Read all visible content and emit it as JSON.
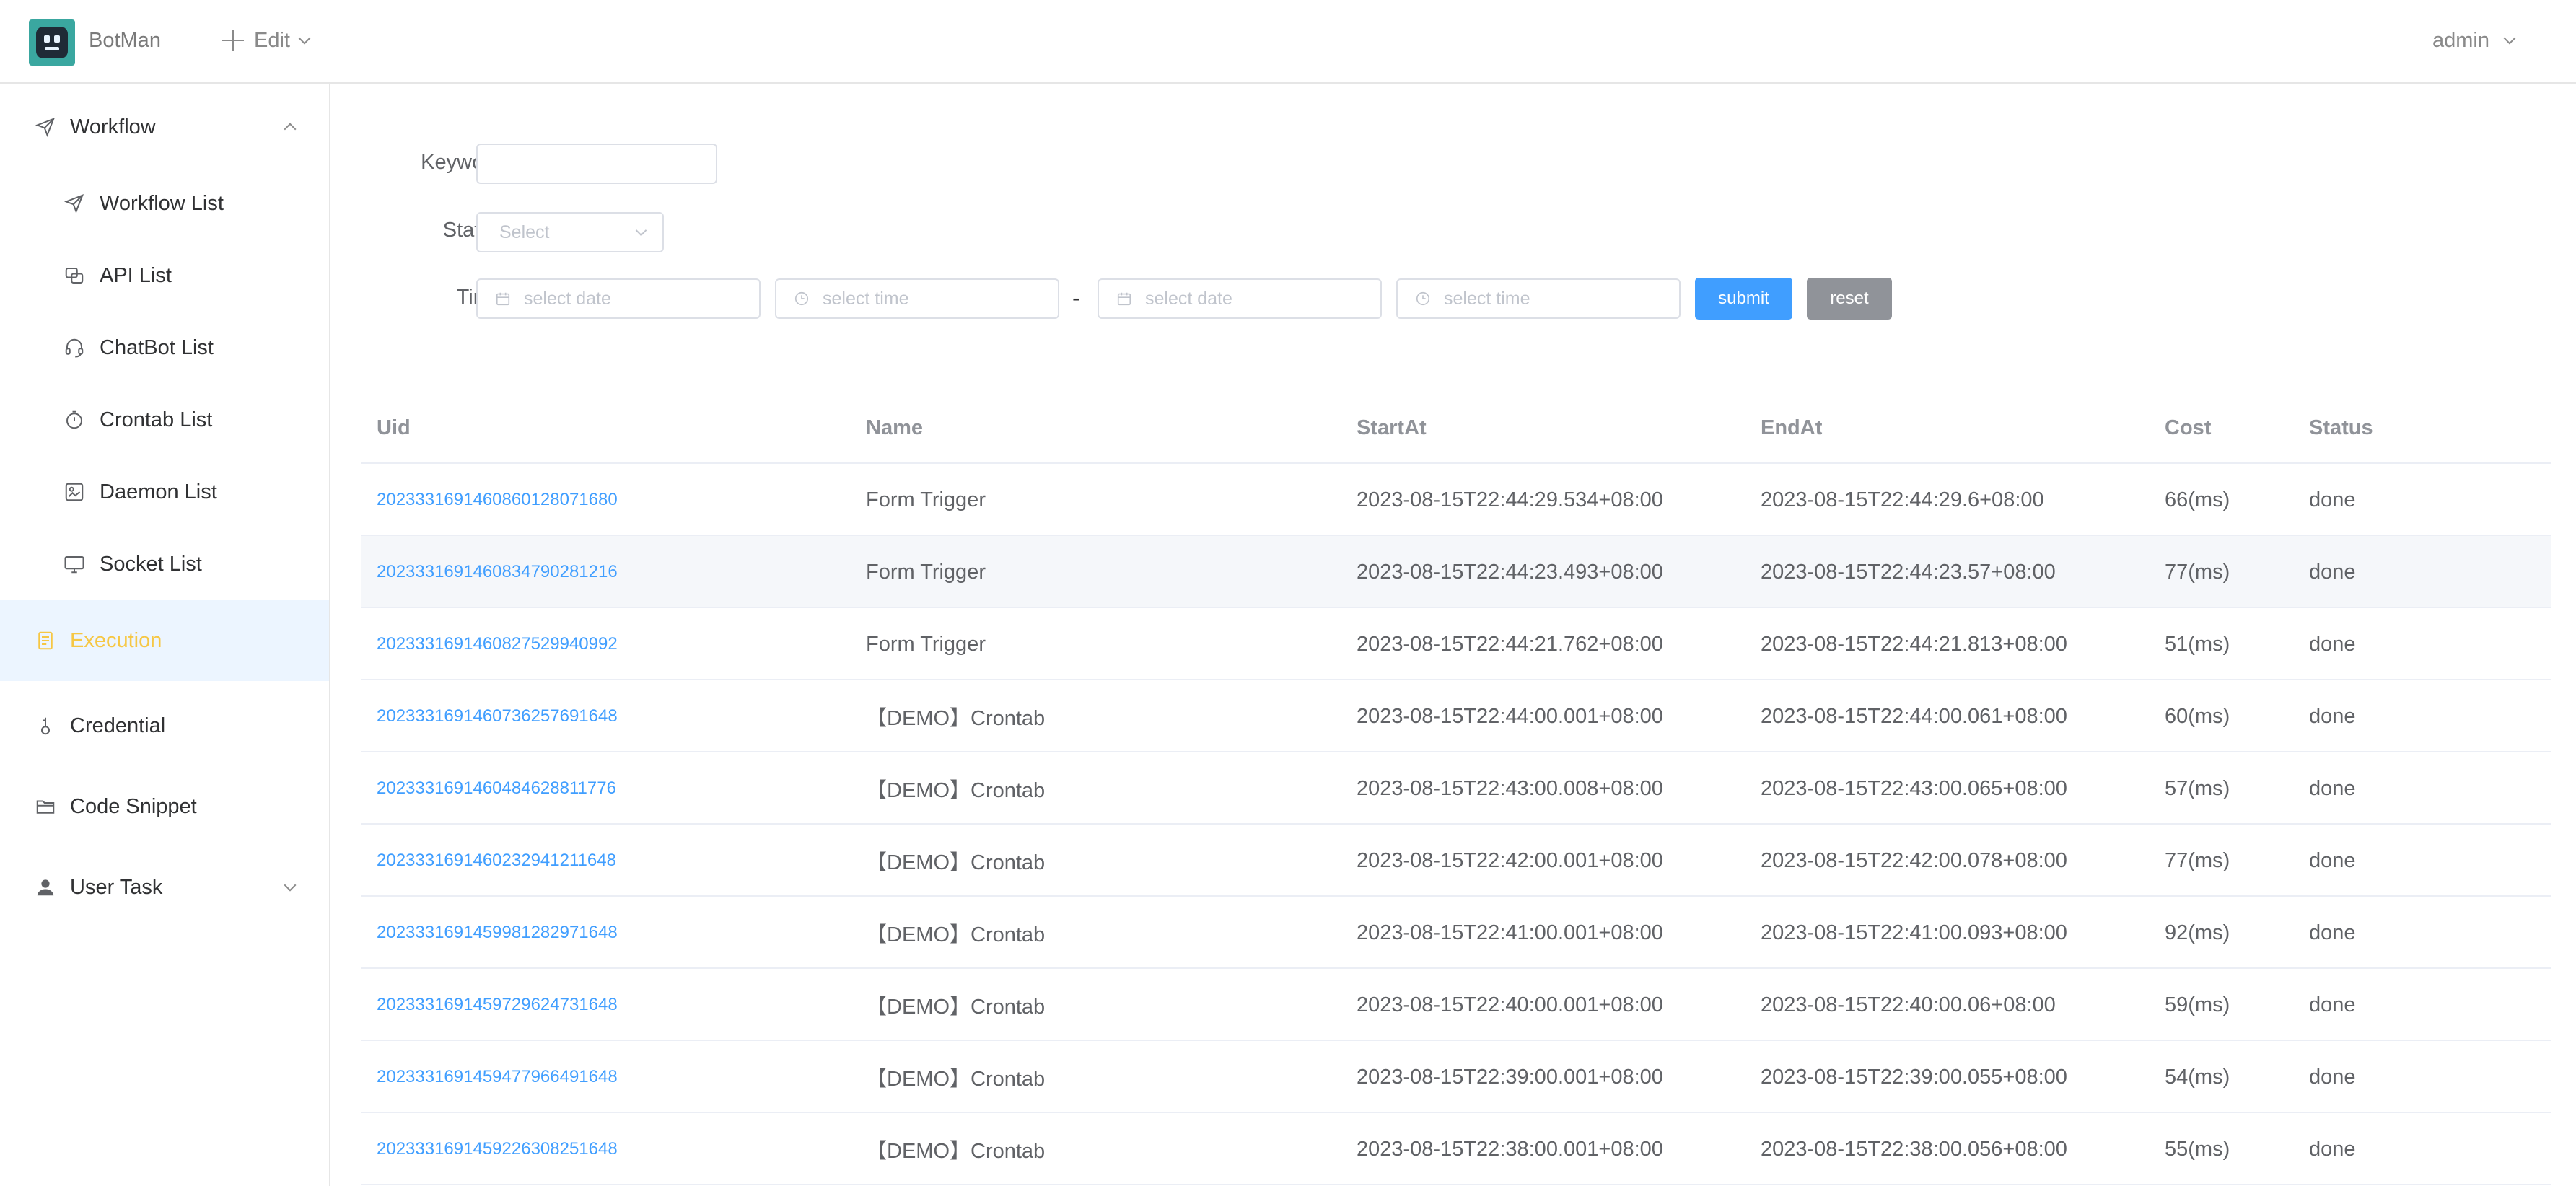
{
  "header": {
    "app_name": "BotMan",
    "edit_label": "Edit",
    "user_label": "admin"
  },
  "sidebar": {
    "items": [
      {
        "label": "Workflow",
        "icon": "send-icon"
      },
      {
        "label": "Workflow List",
        "icon": "send-icon"
      },
      {
        "label": "API List",
        "icon": "api-icon"
      },
      {
        "label": "ChatBot List",
        "icon": "headset-icon"
      },
      {
        "label": "Crontab List",
        "icon": "timer-icon"
      },
      {
        "label": "Daemon List",
        "icon": "daemon-icon"
      },
      {
        "label": "Socket List",
        "icon": "monitor-icon"
      },
      {
        "label": "Execution",
        "icon": "document-icon"
      },
      {
        "label": "Credential",
        "icon": "key-icon"
      },
      {
        "label": "Code Snippet",
        "icon": "folder-icon"
      },
      {
        "label": "User Task",
        "icon": "user-icon"
      }
    ]
  },
  "filters": {
    "keyword_label": "Keyword",
    "keyword_value": "",
    "status_label": "Status",
    "status_placeholder": "Select",
    "time_label": "Time",
    "date_placeholder": "select date",
    "time_placeholder": "select time",
    "range_separator": "-",
    "submit_label": "submit",
    "reset_label": "reset"
  },
  "table": {
    "headers": [
      "Uid",
      "Name",
      "StartAt",
      "EndAt",
      "Cost",
      "Status"
    ],
    "rows": [
      [
        "2023331691460860128071680",
        "Form Trigger",
        "2023-08-15T22:44:29.534+08:00",
        "2023-08-15T22:44:29.6+08:00",
        "66(ms)",
        "done"
      ],
      [
        "2023331691460834790281216",
        "Form Trigger",
        "2023-08-15T22:44:23.493+08:00",
        "2023-08-15T22:44:23.57+08:00",
        "77(ms)",
        "done"
      ],
      [
        "2023331691460827529940992",
        "Form Trigger",
        "2023-08-15T22:44:21.762+08:00",
        "2023-08-15T22:44:21.813+08:00",
        "51(ms)",
        "done"
      ],
      [
        "2023331691460736257691648",
        "【DEMO】Crontab",
        "2023-08-15T22:44:00.001+08:00",
        "2023-08-15T22:44:00.061+08:00",
        "60(ms)",
        "done"
      ],
      [
        "2023331691460484628811776",
        "【DEMO】Crontab",
        "2023-08-15T22:43:00.008+08:00",
        "2023-08-15T22:43:00.065+08:00",
        "57(ms)",
        "done"
      ],
      [
        "2023331691460232941211648",
        "【DEMO】Crontab",
        "2023-08-15T22:42:00.001+08:00",
        "2023-08-15T22:42:00.078+08:00",
        "77(ms)",
        "done"
      ],
      [
        "2023331691459981282971648",
        "【DEMO】Crontab",
        "2023-08-15T22:41:00.001+08:00",
        "2023-08-15T22:41:00.093+08:00",
        "92(ms)",
        "done"
      ],
      [
        "2023331691459729624731648",
        "【DEMO】Crontab",
        "2023-08-15T22:40:00.001+08:00",
        "2023-08-15T22:40:00.06+08:00",
        "59(ms)",
        "done"
      ],
      [
        "2023331691459477966491648",
        "【DEMO】Crontab",
        "2023-08-15T22:39:00.001+08:00",
        "2023-08-15T22:39:00.055+08:00",
        "54(ms)",
        "done"
      ],
      [
        "2023331691459226308251648",
        "【DEMO】Crontab",
        "2023-08-15T22:38:00.001+08:00",
        "2023-08-15T22:38:00.056+08:00",
        "55(ms)",
        "done"
      ]
    ]
  },
  "colors": {
    "primary": "#409eff",
    "active_text": "#f6c744",
    "active_bg": "#ecf5ff",
    "reset_bg": "#909399"
  }
}
